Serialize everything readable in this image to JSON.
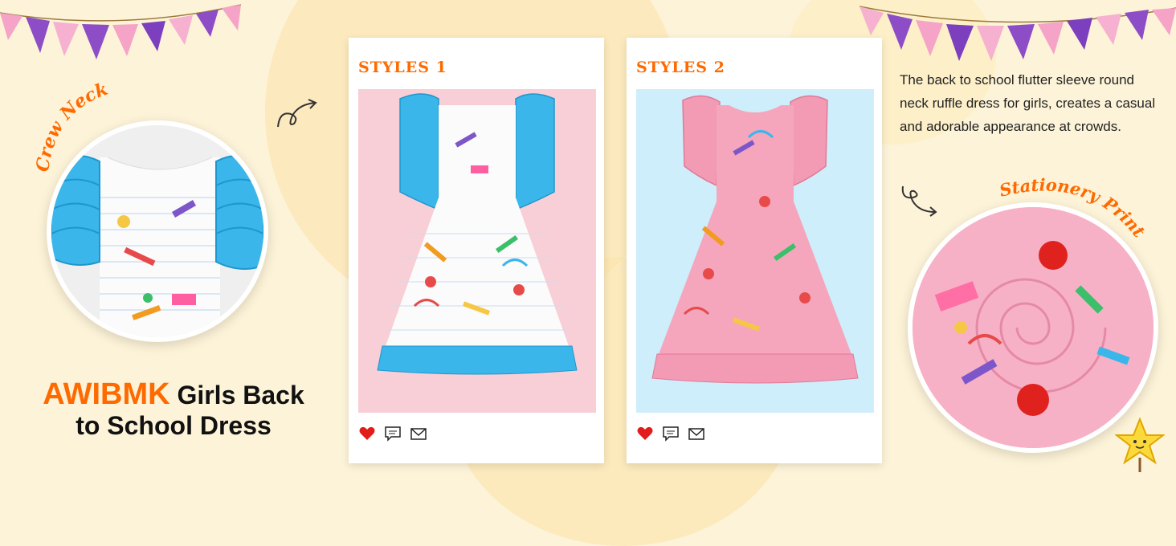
{
  "labels": {
    "crew_neck": "Crew Neck",
    "stationery_print": "Stationery Print"
  },
  "headline": {
    "brand": "AWIBMK",
    "rest_line1": "Girls Back",
    "line2": "to School Dress"
  },
  "cards": [
    {
      "title": "STYLES 1"
    },
    {
      "title": "STYLES 2"
    }
  ],
  "description": "The back to school flutter sleeve round neck ruffle dress for girls, creates a casual and adorable appearance at crowds.",
  "colors": {
    "accent": "#ff6a00",
    "background": "#fdf3d8",
    "card1_bg": "#f8cfd6",
    "card2_bg": "#cdeefa",
    "ruffle_blue": "#3bb6ea",
    "dress_pink": "#f39bb4",
    "heart": "#e21b1b"
  },
  "icons": [
    "heart-icon",
    "comment-icon",
    "mail-icon",
    "arrow-icon",
    "star-icon",
    "bunting"
  ]
}
